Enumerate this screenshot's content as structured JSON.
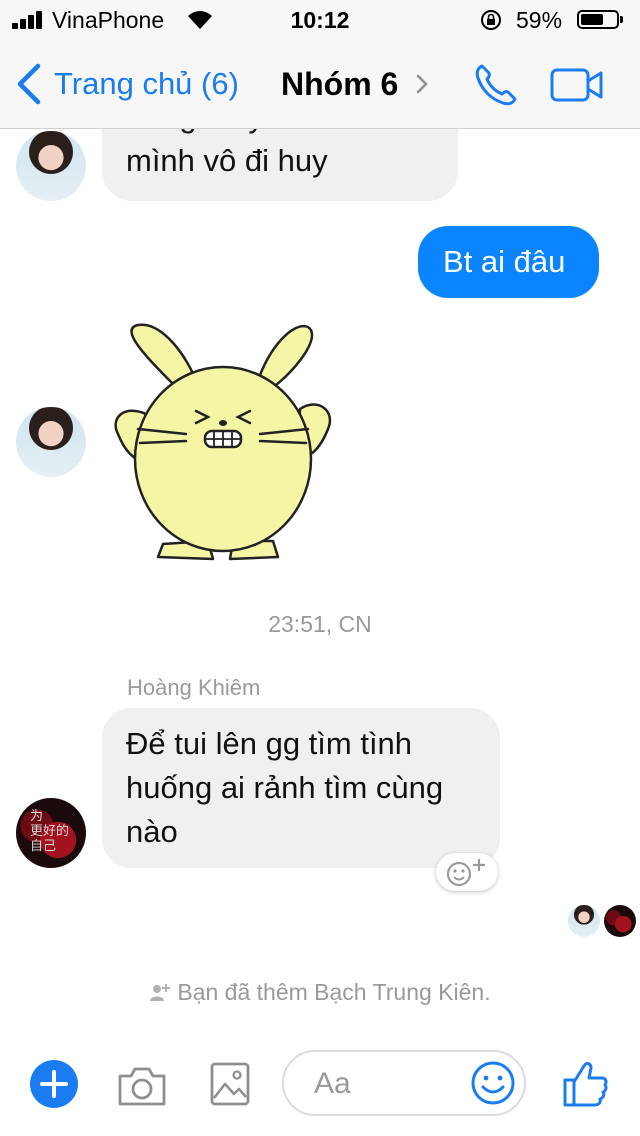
{
  "status_bar": {
    "carrier": "VinaPhone",
    "time": "10:12",
    "battery_percent": "59%",
    "battery_level": 0.59,
    "icons": [
      "signal-icon",
      "wifi-icon",
      "rotation-lock-icon",
      "battery-icon"
    ]
  },
  "nav": {
    "back_label": "Trang chủ (6)",
    "title": "Nhóm 6",
    "icons": [
      "chevron-left-icon",
      "chevron-right-icon",
      "phone-icon",
      "video-icon"
    ],
    "accent_color": "#1a7cf0"
  },
  "messages": [
    {
      "type": "incoming",
      "text_line1": "Tùng mấy đứa nhóm",
      "text_line2": "mình vô đi huy"
    },
    {
      "type": "outgoing",
      "text": "Bt ai đâu"
    },
    {
      "type": "sticker",
      "sticker_name": "yellow-bunny-sticker"
    },
    {
      "type": "timestamp",
      "text": "23:51, CN"
    },
    {
      "type": "sender",
      "text": "Hoàng Khiêm"
    },
    {
      "type": "incoming",
      "text_line1": "Để tui lên gg tìm tình",
      "text_line2": "huống ai rảnh tìm cùng",
      "text_line3": "nào"
    }
  ],
  "avatar_red_text": [
    "为",
    "更好的",
    "自己"
  ],
  "system_note": "Bạn đã thêm Bạch Trung Kiên.",
  "composer": {
    "placeholder": "Aa",
    "icons": [
      "plus-icon",
      "camera-icon",
      "image-icon",
      "emoji-icon",
      "thumbs-up-icon"
    ]
  },
  "colors": {
    "outgoing_bubble": "#0b84ff",
    "incoming_bubble": "#f1f0f0",
    "sticker_yellow": "#f5f5a6"
  }
}
